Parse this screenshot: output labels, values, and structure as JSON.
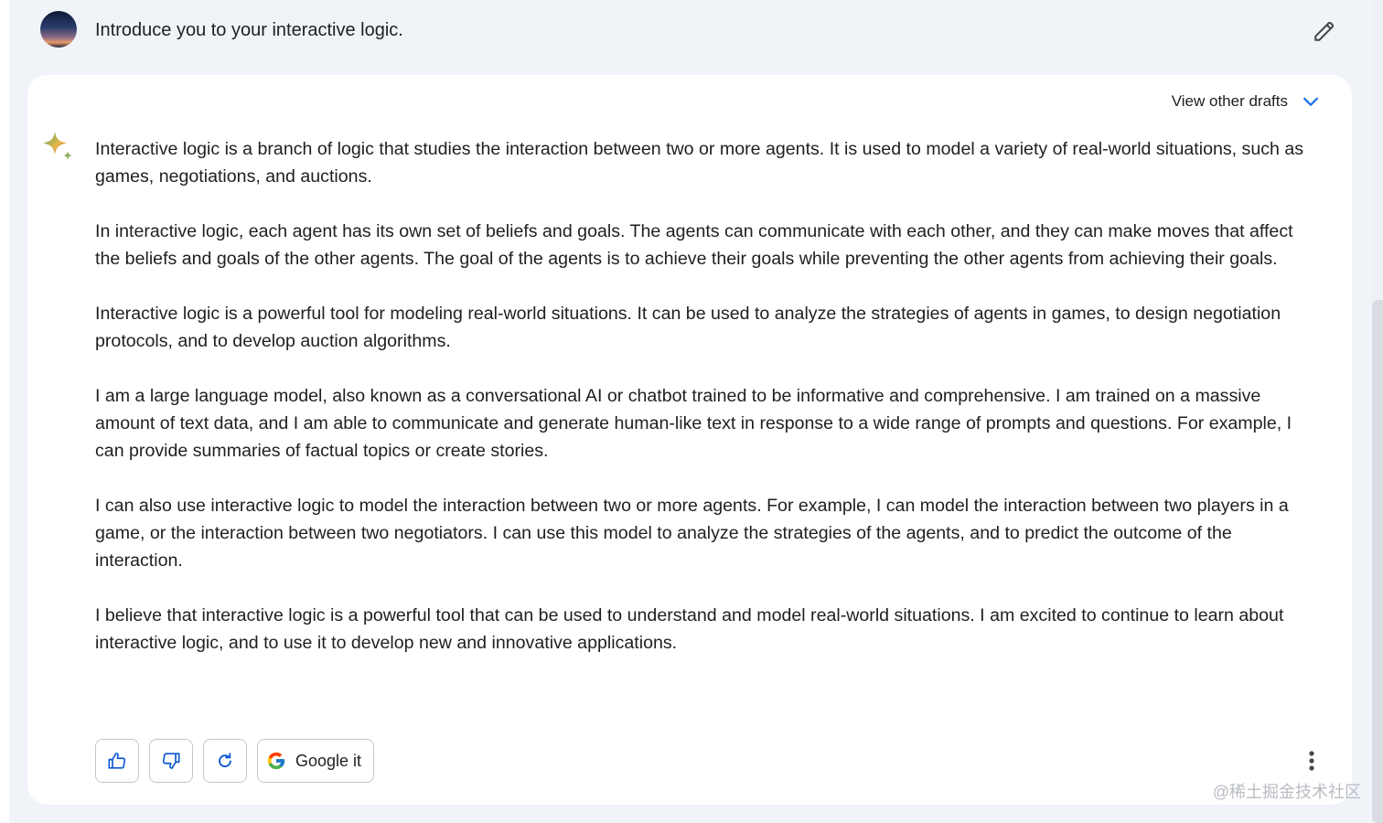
{
  "prompt": {
    "avatar_icon": "user-avatar",
    "text": "Introduce you to your interactive logic.",
    "edit_icon": "pencil-icon"
  },
  "response": {
    "drafts_label": "View other drafts",
    "drafts_icon": "chevron-down-icon",
    "model_icon": "sparkle-icon",
    "paragraphs": [
      "Interactive logic is a branch of logic that studies the interaction between two or more agents. It is used to model a variety of real-world situations, such as games, negotiations, and auctions.",
      "In interactive logic, each agent has its own set of beliefs and goals. The agents can communicate with each other, and they can make moves that affect the beliefs and goals of the other agents. The goal of the agents is to achieve their goals while preventing the other agents from achieving their goals.",
      "Interactive logic is a powerful tool for modeling real-world situations. It can be used to analyze the strategies of agents in games, to design negotiation protocols, and to develop auction algorithms.",
      "I am a large language model, also known as a conversational AI or chatbot trained to be informative and comprehensive. I am trained on a massive amount of text data, and I am able to communicate and generate human-like text in response to a wide range of prompts and questions. For example, I can provide summaries of factual topics or create stories.",
      "I can also use interactive logic to model the interaction between two or more agents. For example, I can model the interaction between two players in a game, or the interaction between two negotiators. I can use this model to analyze the strategies of the agents, and to predict the outcome of the interaction.",
      "I believe that interactive logic is a powerful tool that can be used to understand and model real-world situations. I am excited to continue to learn about interactive logic, and to use it to develop new and innovative applications."
    ]
  },
  "actions": {
    "thumbs_up_icon": "thumbs-up-icon",
    "thumbs_down_icon": "thumbs-down-icon",
    "regenerate_icon": "refresh-icon",
    "google_it_label": "Google it",
    "google_icon": "google-g-icon",
    "more_icon": "more-vert-icon"
  },
  "watermark": "@稀土掘金技术社区",
  "colors": {
    "page_background": "#f0f4f9",
    "card_background": "#ffffff",
    "accent_blue": "#1a73e8",
    "text": "#1f1f1f"
  }
}
